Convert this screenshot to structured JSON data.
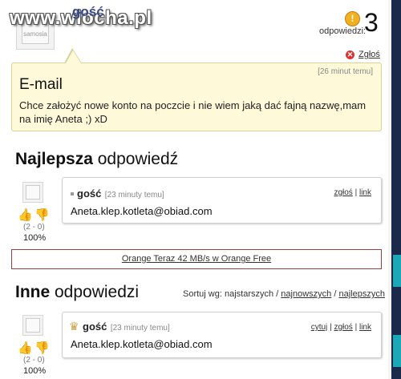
{
  "watermark": "www.wiocha.pl",
  "question": {
    "author": "gość",
    "avatar_text": "samosia",
    "answers_label": "odpowiedzi:",
    "answers_icon_glyph": "!",
    "answers_count": "3",
    "report_label": "Zgłoś",
    "time": "[26 minut temu]",
    "title": "E-mail",
    "body": "Chce założyć nowe konto na poczcie i nie wiem jaką dać fajną nazwę,mam na imię Aneta ;) xD"
  },
  "best": {
    "heading_bold": "Najlepsza",
    "heading_rest": " odpowiedź",
    "author": "gość",
    "time": "[23 minuty temu]",
    "link_report": "zgłoś",
    "separator": "|",
    "link_link": "link",
    "text": "Aneta.klep.kotleta@obiad.com",
    "avatar_text": "samosia",
    "vote_counts": "(2 - 0)",
    "vote_pct": "100%"
  },
  "ad": {
    "text": "Orange Teraz 42 MB/s w Orange Free"
  },
  "others": {
    "heading_bold": "Inne",
    "heading_rest": " odpowiedzi",
    "sort_label": "Sortuj wg: najstarszych",
    "sort_sep": "/",
    "sort_newest": "najnowszych",
    "sort_best": "najlepszych",
    "items": [
      {
        "author": "gość",
        "time": "[23 minuty temu]",
        "link_quote": "cytuj",
        "link_report": "zgłoś",
        "link_link": "link",
        "separator": "|",
        "text": "Aneta.klep.kotleta@obiad.com",
        "avatar_text": "samosia",
        "vote_counts": "(2 - 0)",
        "vote_pct": "100%"
      }
    ]
  },
  "colors": {
    "question_bg": "#fdf9d9",
    "ad_border": "#9a4040",
    "vote_up": "#c04a9a",
    "vote_down": "#e6a10c"
  },
  "icons": {
    "answers": "exclamation-icon",
    "report": "close-circle-icon",
    "crown": "crown-icon",
    "thumbs_up": "thumbs-up-icon",
    "thumbs_down": "thumbs-down-icon"
  }
}
